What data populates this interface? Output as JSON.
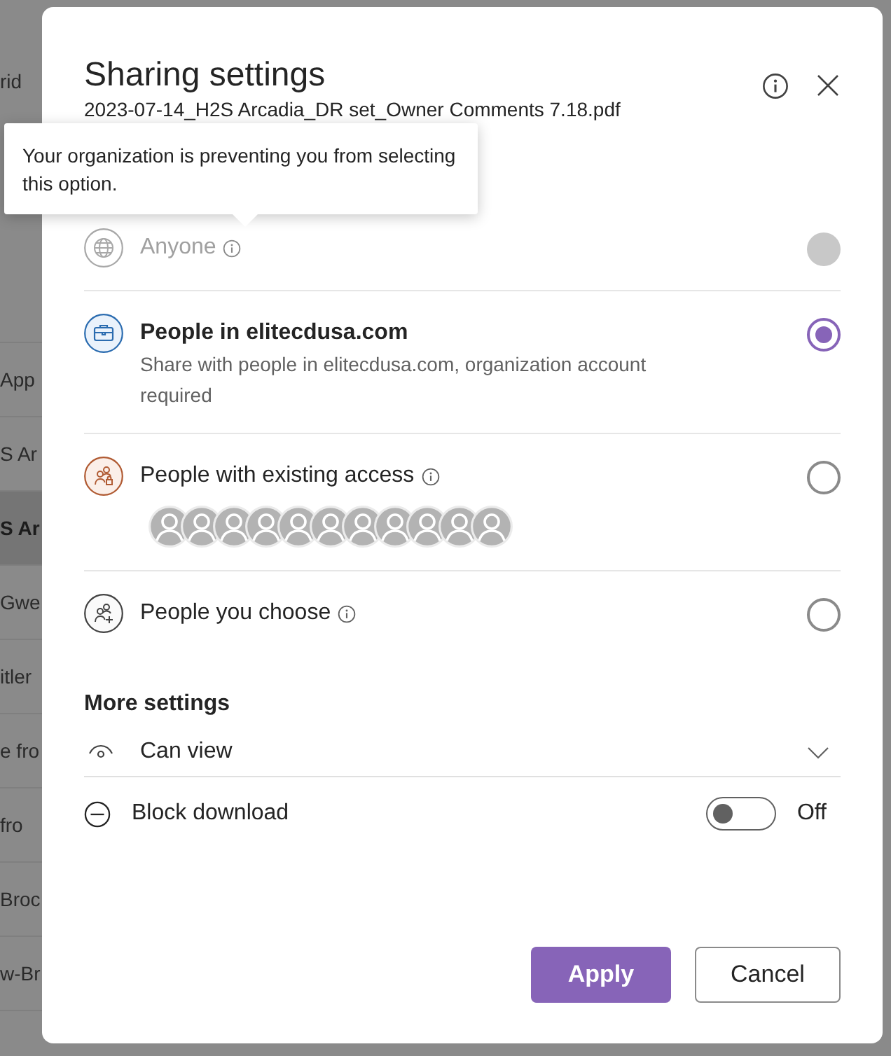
{
  "background_list": {
    "rows": [
      {
        "text": "rid",
        "highlighted": false
      },
      {
        "text": "App",
        "highlighted": false
      },
      {
        "text": "S Ar",
        "highlighted": false
      },
      {
        "text": "S Ar",
        "highlighted": true
      },
      {
        "text": "Gwe",
        "highlighted": false
      },
      {
        "text": "itler",
        "highlighted": false
      },
      {
        "text": "e fro",
        "highlighted": false
      },
      {
        "text": "fro",
        "highlighted": false
      },
      {
        "text": "Broc",
        "highlighted": false
      },
      {
        "text": "w-Br",
        "highlighted": false
      }
    ]
  },
  "dialog": {
    "title": "Sharing settings",
    "subtitle": "2023-07-14_H2S Arcadia_DR set_Owner Comments 7.18.pdf",
    "tooltip": {
      "text": "Your organization is preventing you from selecting this option."
    },
    "options": [
      {
        "kind": "globe",
        "title": "Anyone",
        "info": true,
        "disabled": true,
        "selected": false
      },
      {
        "kind": "briefcase",
        "title": "People in elitecdusa.com",
        "description": "Share with people in elitecdusa.com, organization account required",
        "info": false,
        "disabled": false,
        "selected": true
      },
      {
        "kind": "people-lock",
        "title": "People with existing access",
        "info": true,
        "disabled": false,
        "selected": false,
        "avatars": [
          {
            "kind": "placeholder"
          },
          {
            "kind": "placeholder"
          },
          {
            "kind": "placeholder"
          },
          {
            "kind": "placeholder"
          },
          {
            "kind": "placeholder"
          },
          {
            "kind": "placeholder"
          },
          {
            "kind": "placeholder"
          },
          {
            "kind": "placeholder"
          },
          {
            "kind": "placeholder"
          },
          {
            "kind": "placeholder"
          },
          {
            "kind": "placeholder"
          }
        ]
      },
      {
        "kind": "people-add",
        "title": "People you choose",
        "info": true,
        "disabled": false,
        "selected": false
      }
    ],
    "more_settings": {
      "heading": "More settings",
      "permission": {
        "label": "Can view"
      },
      "block_download": {
        "label": "Block download",
        "on": false,
        "state_text": "Off"
      }
    },
    "buttons": [
      {
        "kind": "primary",
        "label": "Apply"
      },
      {
        "kind": "secondary",
        "label": "Cancel"
      }
    ]
  }
}
